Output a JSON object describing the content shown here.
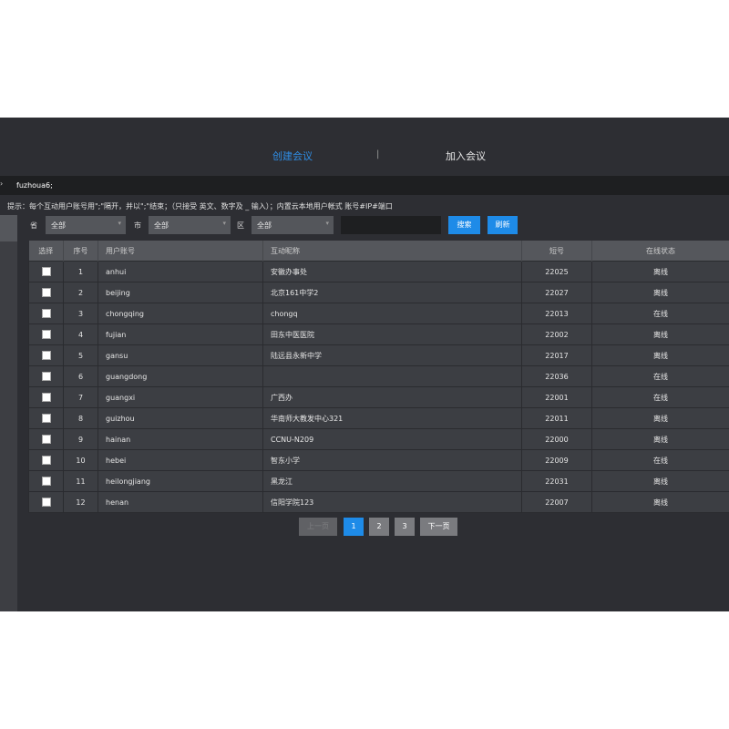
{
  "tabs": {
    "create": "创建会议",
    "separator": "|",
    "join": "加入会议"
  },
  "account_input": {
    "value": "fuzhoua6;",
    "arrow": "›"
  },
  "hint": "提示：每个互动用户账号用\";\"隔开，并以\";\"结束；（只接受 英文、数字及 _ 输入）；内置云本地用户帐式 账号#IP#端口",
  "filters": {
    "province_label": "省",
    "province_value": "全部",
    "city_label": "市",
    "city_value": "全部",
    "district_label": "区",
    "district_value": "全部",
    "keyword_value": "",
    "search_button": "搜索",
    "refresh_button": "刷新"
  },
  "table": {
    "headers": [
      "选择",
      "序号",
      "用户账号",
      "互动昵称",
      "短号",
      "在线状态"
    ],
    "rows": [
      {
        "index": "1",
        "account": "anhui",
        "nickname": "安徽办事处",
        "short": "22025",
        "status": "离线"
      },
      {
        "index": "2",
        "account": "beijing",
        "nickname": "北京161中学2",
        "short": "22027",
        "status": "离线"
      },
      {
        "index": "3",
        "account": "chongqing",
        "nickname": "chongq",
        "short": "22013",
        "status": "在线"
      },
      {
        "index": "4",
        "account": "fujian",
        "nickname": "田东中医医院",
        "short": "22002",
        "status": "离线"
      },
      {
        "index": "5",
        "account": "gansu",
        "nickname": "陆远县永新中学",
        "short": "22017",
        "status": "离线"
      },
      {
        "index": "6",
        "account": "guangdong",
        "nickname": "",
        "short": "22036",
        "status": "在线"
      },
      {
        "index": "7",
        "account": "guangxi",
        "nickname": "广西办",
        "short": "22001",
        "status": "在线"
      },
      {
        "index": "8",
        "account": "guizhou",
        "nickname": "华南师大教发中心321",
        "short": "22011",
        "status": "离线"
      },
      {
        "index": "9",
        "account": "hainan",
        "nickname": "CCNU-N209",
        "short": "22000",
        "status": "离线"
      },
      {
        "index": "10",
        "account": "hebei",
        "nickname": "智东小学",
        "short": "22009",
        "status": "在线"
      },
      {
        "index": "11",
        "account": "heilongjiang",
        "nickname": "黑龙江",
        "short": "22031",
        "status": "离线"
      },
      {
        "index": "12",
        "account": "henan",
        "nickname": "信阳学院123",
        "short": "22007",
        "status": "离线"
      }
    ]
  },
  "pager": {
    "prev": "上一页",
    "pages": [
      "1",
      "2",
      "3"
    ],
    "current_page": "1",
    "next": "下一页"
  },
  "colors": {
    "accent": "#1e8be8",
    "background": "#2d2e33",
    "header": "#55575c"
  }
}
